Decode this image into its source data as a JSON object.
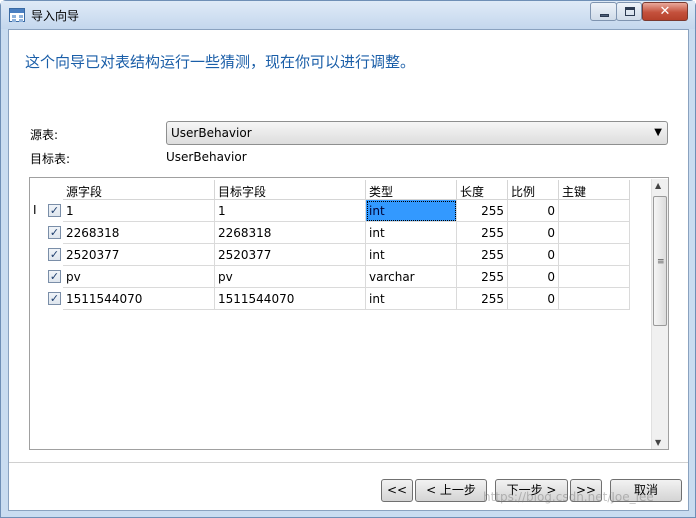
{
  "window": {
    "title": "导入向导",
    "close_glyph": "✕"
  },
  "heading": "这个向导已对表结构运行一些猜测，现在你可以进行调整。",
  "source_table": {
    "label": "源表:",
    "value": "UserBehavior",
    "arrow": "▼"
  },
  "target_table": {
    "label": "目标表:",
    "value": "UserBehavior"
  },
  "grid": {
    "columns": [
      "源字段",
      "目标字段",
      "类型",
      "长度",
      "比例",
      "主键"
    ],
    "row_indicator": "I",
    "check_glyph": "✓",
    "rows": [
      {
        "checked": true,
        "source": "1",
        "target": "1",
        "type": "int",
        "length": "255",
        "scale": "0",
        "pk": ""
      },
      {
        "checked": true,
        "source": "2268318",
        "target": "2268318",
        "type": "int",
        "length": "255",
        "scale": "0",
        "pk": ""
      },
      {
        "checked": true,
        "source": "2520377",
        "target": "2520377",
        "type": "int",
        "length": "255",
        "scale": "0",
        "pk": ""
      },
      {
        "checked": true,
        "source": "pv",
        "target": "pv",
        "type": "varchar",
        "length": "255",
        "scale": "0",
        "pk": ""
      },
      {
        "checked": true,
        "source": "1511544070",
        "target": "1511544070",
        "type": "int",
        "length": "255",
        "scale": "0",
        "pk": ""
      }
    ],
    "scroll_up": "▲",
    "scroll_down": "▼",
    "scroll_grip": "≡"
  },
  "buttons": {
    "first": "<<",
    "prev": "< 上一步",
    "next": "下一步 >",
    "last": ">>",
    "cancel": "取消"
  },
  "watermark": "https://blog.csdn.net/Joe_lee"
}
